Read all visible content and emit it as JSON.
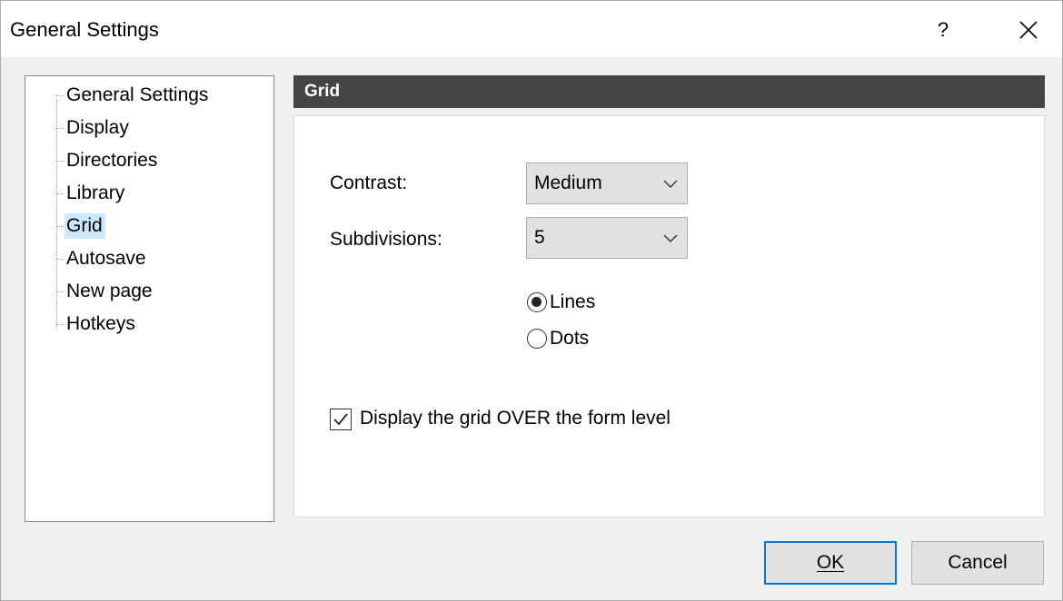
{
  "window": {
    "title": "General Settings",
    "help_label": "?"
  },
  "tree": {
    "items": [
      {
        "label": "General Settings"
      },
      {
        "label": "Display"
      },
      {
        "label": "Directories"
      },
      {
        "label": "Library"
      },
      {
        "label": "Grid",
        "selected": true
      },
      {
        "label": "Autosave"
      },
      {
        "label": "New page"
      },
      {
        "label": "Hotkeys"
      }
    ]
  },
  "panel": {
    "header": "Grid",
    "contrast": {
      "label": "Contrast:",
      "value": "Medium"
    },
    "subdivisions": {
      "label": "Subdivisions:",
      "value": "5"
    },
    "style_options": [
      {
        "label": "Lines",
        "selected": true
      },
      {
        "label": "Dots",
        "selected": false
      }
    ],
    "over_form": {
      "label": "Display the grid OVER the form level",
      "checked": true
    }
  },
  "buttons": {
    "ok": "OK",
    "cancel": "Cancel"
  },
  "colors": {
    "header_bg": "#444444",
    "selection_bg": "#cce8ff",
    "default_button_border": "#0078d7"
  }
}
